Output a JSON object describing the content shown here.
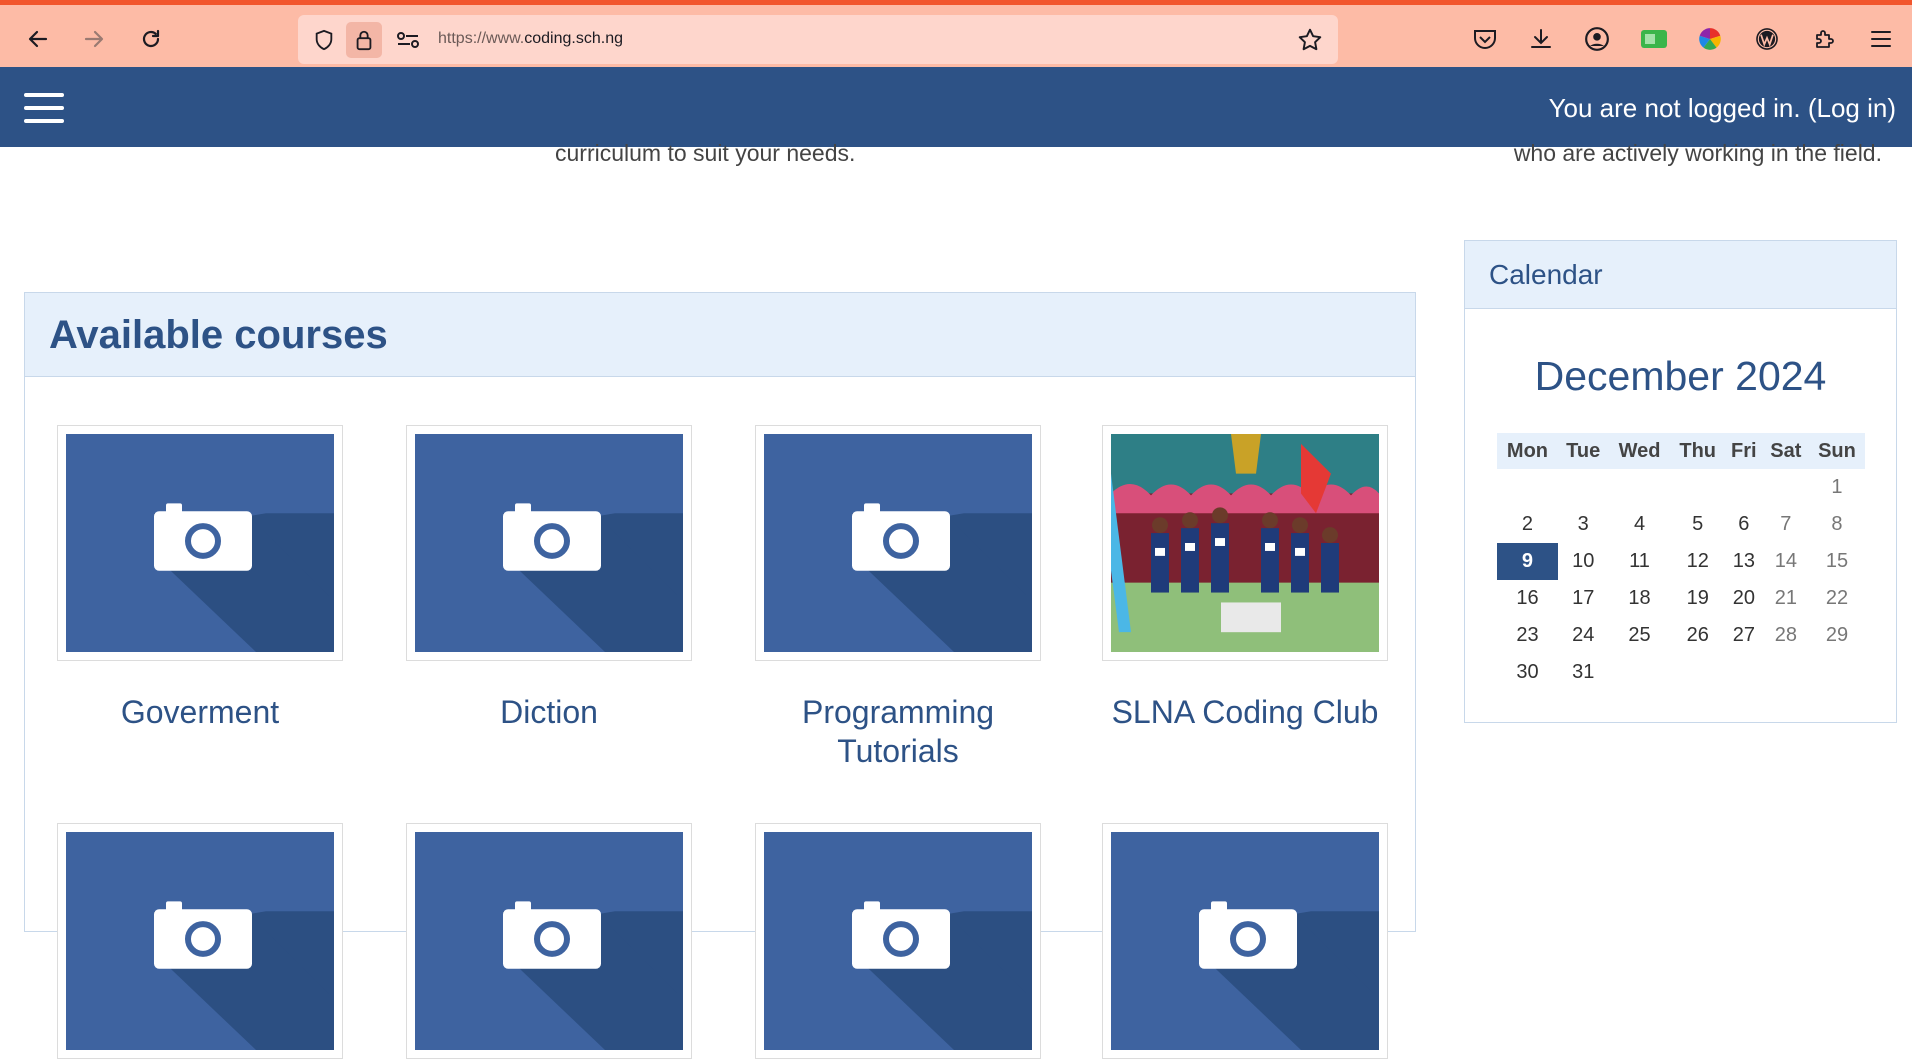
{
  "browser": {
    "url_prefix": "https://www.",
    "url_host": "coding.sch.ng",
    "colors": {
      "tab_accent": "#f2552c",
      "toolbar": "#fdbba6"
    }
  },
  "site": {
    "login_text": "You are not logged in. (Log in)",
    "intro_left": "curriculum to suit your needs.",
    "intro_right": "who are actively working in the field."
  },
  "courses": {
    "title": "Available courses",
    "items": [
      {
        "name": "Goverment",
        "image": "placeholder-camera"
      },
      {
        "name": "Diction",
        "image": "placeholder-camera"
      },
      {
        "name": "Programming Tutorials",
        "image": "placeholder-camera"
      },
      {
        "name": "SLNA Coding Club",
        "image": "photo-trophy-ceremony"
      },
      {
        "name": "",
        "image": "placeholder-camera"
      },
      {
        "name": "",
        "image": "placeholder-camera"
      },
      {
        "name": "",
        "image": "placeholder-camera"
      },
      {
        "name": "",
        "image": "placeholder-camera"
      }
    ]
  },
  "calendar": {
    "title": "Calendar",
    "month": "December 2024",
    "weekdays": [
      "Mon",
      "Tue",
      "Wed",
      "Thu",
      "Fri",
      "Sat",
      "Sun"
    ],
    "weeks": [
      [
        "",
        "",
        "",
        "",
        "",
        "",
        "1"
      ],
      [
        "2",
        "3",
        "4",
        "5",
        "6",
        "7",
        "8"
      ],
      [
        "9",
        "10",
        "11",
        "12",
        "13",
        "14",
        "15"
      ],
      [
        "16",
        "17",
        "18",
        "19",
        "20",
        "21",
        "22"
      ],
      [
        "23",
        "24",
        "25",
        "26",
        "27",
        "28",
        "29"
      ],
      [
        "30",
        "31",
        "",
        "",
        "",
        "",
        ""
      ]
    ],
    "today": "9"
  }
}
